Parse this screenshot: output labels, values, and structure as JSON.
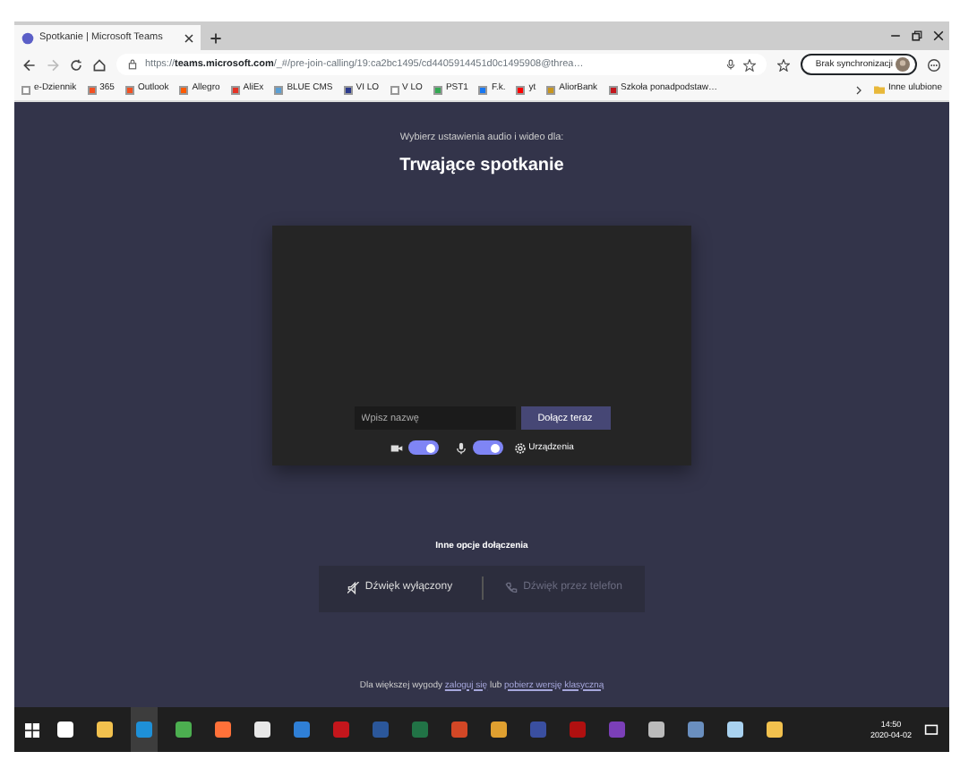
{
  "browser": {
    "tab": {
      "title": "Spotkanie | Microsoft Teams",
      "selected": true
    },
    "url_scheme": "https://",
    "url_host": "teams.microsoft.com",
    "url_path": "/_#/pre-join-calling/19:ca2bc1495/cd4405914451d0c1495908@threa…",
    "profile": "Brak synchronizacji",
    "bookmarks": [
      {
        "label": "e-Dziennik",
        "color": "#ffffff"
      },
      {
        "label": "365",
        "color": "#f25022"
      },
      {
        "label": "Outlook",
        "color": "#f25022"
      },
      {
        "label": "Allegro",
        "color": "#ff5a00"
      },
      {
        "label": "AliEx",
        "color": "#e43225"
      },
      {
        "label": "BLUE CMS",
        "color": "#5a9fd4"
      },
      {
        "label": "VI LO",
        "color": "#2b3a8c"
      },
      {
        "label": "V LO",
        "color": "#ffffff"
      },
      {
        "label": "PST1",
        "color": "#34a853"
      },
      {
        "label": "F.k.",
        "color": "#1877f2"
      },
      {
        "label": "yt",
        "color": "#ff0000"
      },
      {
        "label": "AliorBank",
        "color": "#c8961e"
      },
      {
        "label": "Szkoła ponadpodstaw…",
        "color": "#c4161c"
      }
    ],
    "other_bookmarks": "Inne ulubione"
  },
  "prejoin": {
    "subtitle": "Wybierz ustawienia audio i wideo dla:",
    "title": "Trwające spotkanie",
    "name_field": {
      "placeholder": "Wpisz nazwę"
    },
    "join_button": "Dołącz teraz",
    "camera": {
      "on": true
    },
    "microphone": {
      "on": true
    },
    "devices": "Urządzenia"
  },
  "other_options": {
    "heading": "Inne opcje dołączenia",
    "options": [
      {
        "label": "Dźwięk wyłączony",
        "disabled": false,
        "kind": "audio-off"
      },
      {
        "label": "Dźwięk przez telefon",
        "disabled": true,
        "kind": "phone"
      }
    ]
  },
  "footer": {
    "before": "Dla większej wygody",
    "link1": "zaloguj się",
    "middle": "lub",
    "link2": "pobierz wersję klasyczną"
  },
  "taskbar": {
    "apps": [
      {
        "color": "#ffffff",
        "selected": false
      },
      {
        "color": "#f2c14e",
        "selected": false
      },
      {
        "color": "#1e90d8",
        "selected": true
      },
      {
        "color": "#4caf50",
        "selected": false
      },
      {
        "color": "#ff7139",
        "selected": false
      },
      {
        "color": "#e8e8e8",
        "selected": false
      },
      {
        "color": "#2f7fd6",
        "selected": false
      },
      {
        "color": "#c4161c",
        "selected": false
      },
      {
        "color": "#2b579a",
        "selected": false
      },
      {
        "color": "#217346",
        "selected": false
      },
      {
        "color": "#d24726",
        "selected": false
      },
      {
        "color": "#e0a030",
        "selected": false
      },
      {
        "color": "#3a4fa0",
        "selected": false
      },
      {
        "color": "#b01010",
        "selected": false
      },
      {
        "color": "#7b3fb8",
        "selected": false
      },
      {
        "color": "#bbbbbb",
        "selected": false
      },
      {
        "color": "#6a8fbf",
        "selected": false
      },
      {
        "color": "#a9d2f0",
        "selected": false
      },
      {
        "color": "#f2c14e",
        "selected": false
      }
    ],
    "time": "14:50",
    "date": "2020-04-02"
  }
}
